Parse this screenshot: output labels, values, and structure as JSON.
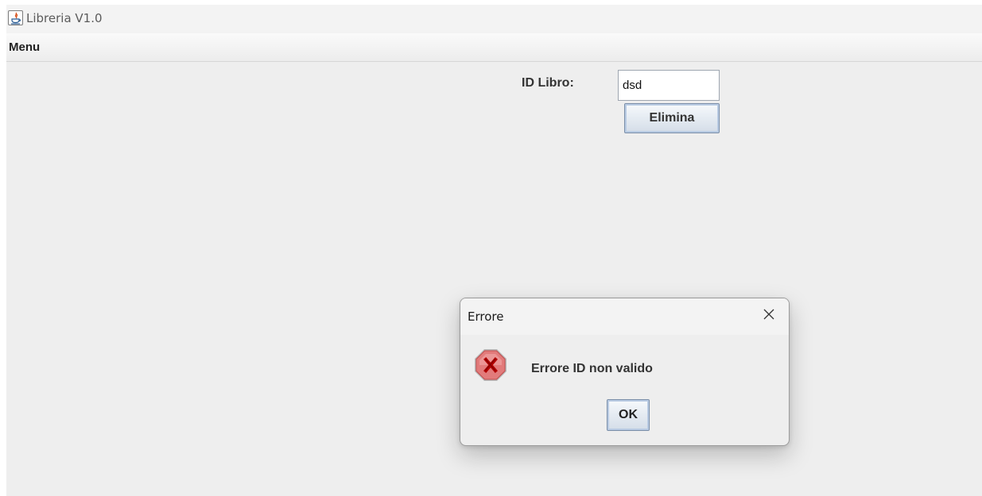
{
  "window": {
    "title": "Libreria V1.0",
    "icon": "java-icon"
  },
  "menubar": {
    "menu_label": "Menu"
  },
  "form": {
    "id_label": "ID Libro:",
    "id_value": "dsd",
    "delete_button": "Elimina"
  },
  "dialog": {
    "title": "Errore",
    "close_icon": "close-icon",
    "icon": "error-icon",
    "message": "Errore ID non valido",
    "ok_button": "OK"
  },
  "colors": {
    "error_icon_fill": "#e27b7b",
    "error_icon_x": "#b20000",
    "button_border": "#7a8ea8"
  }
}
